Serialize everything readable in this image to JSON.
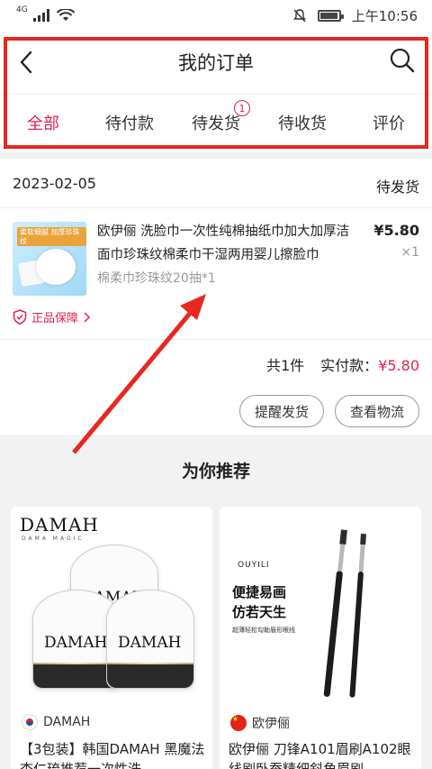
{
  "status_bar": {
    "network": "4G",
    "time": "上午10:56"
  },
  "header": {
    "title": "我的订单",
    "tabs": [
      {
        "label": "全部",
        "active": true
      },
      {
        "label": "待付款"
      },
      {
        "label": "待发货",
        "badge": "1"
      },
      {
        "label": "待收货"
      },
      {
        "label": "评价"
      }
    ]
  },
  "order": {
    "date": "2023-02-05",
    "status": "待发货",
    "product": {
      "image_tag": "柔软细腻 加厚珍珠纹",
      "name": "欧伊俪 洗脸巾一次性纯棉抽纸巾加大加厚洁面巾珍珠纹棉柔巾干湿两用婴儿擦脸巾",
      "spec": "棉柔巾珍珠纹20抽*1",
      "price": "¥5.80",
      "qty": "×1"
    },
    "guarantee": "正品保障",
    "total_count": "共1件",
    "paid_label": "实付款：",
    "paid_amount": "¥5.80",
    "buttons": {
      "remind": "提醒发货",
      "logistics": "查看物流"
    }
  },
  "recommend": {
    "title": "为你推荐",
    "items": [
      {
        "logo": "DAMAH",
        "logo_sub": "DAMA MAGIC",
        "brand": "DAMAH",
        "name": "【3包装】韩国DAMAH 黑魔法杏仁琉推荐一次性洗"
      },
      {
        "logo": "OUYILI",
        "line1": "便捷易画",
        "line2": "仿若天生",
        "line3": "超薄轻松勾勒眉形眼线",
        "brand": "欧伊俪",
        "name": "欧伊俪 刀锋A101眉刷A102眼线刷卧蚕精细斜角眉刷"
      }
    ]
  },
  "colors": {
    "accent": "#e0214f",
    "annotation": "#e8271f"
  }
}
